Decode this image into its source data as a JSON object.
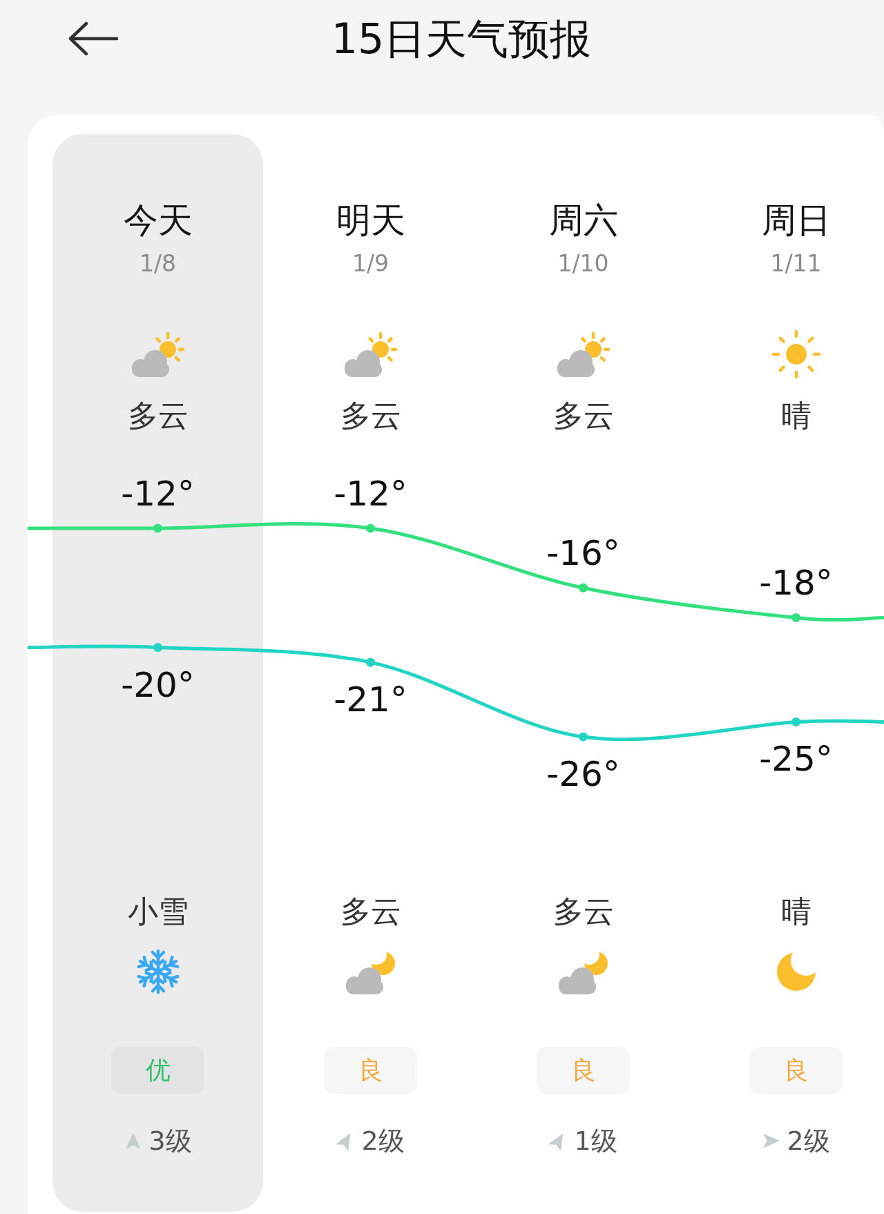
{
  "header": {
    "title": "15日天气预报"
  },
  "forecast": {
    "days": [
      {
        "name": "今天",
        "date": "1/8",
        "selected": true,
        "day_icon": {
          "kind": "partly-cloudy"
        },
        "day_condition": "多云",
        "night_condition": "小雪",
        "night_icon": {
          "kind": "snow"
        },
        "aqi": {
          "label": "优",
          "color": "#2dbf6a"
        },
        "wind_arrow": {
          "kind": "up"
        },
        "wind": "3级"
      },
      {
        "name": "明天",
        "date": "1/9",
        "selected": false,
        "day_icon": {
          "kind": "partly-cloudy"
        },
        "day_condition": "多云",
        "night_condition": "多云",
        "night_icon": {
          "kind": "partly-cloudy-night"
        },
        "aqi": {
          "label": "良",
          "color": "#f5a83a"
        },
        "wind_arrow": {
          "kind": "up-right"
        },
        "wind": "2级"
      },
      {
        "name": "周六",
        "date": "1/10",
        "selected": false,
        "day_icon": {
          "kind": "partly-cloudy"
        },
        "day_condition": "多云",
        "night_condition": "多云",
        "night_icon": {
          "kind": "partly-cloudy-night"
        },
        "aqi": {
          "label": "良",
          "color": "#f5a83a"
        },
        "wind_arrow": {
          "kind": "up-right"
        },
        "wind": "1级"
      },
      {
        "name": "周日",
        "date": "1/11",
        "selected": false,
        "day_icon": {
          "kind": "sunny"
        },
        "day_condition": "晴",
        "night_condition": "晴",
        "night_icon": {
          "kind": "clear-night"
        },
        "aqi": {
          "label": "良",
          "color": "#f5a83a"
        },
        "wind_arrow": {
          "kind": "right"
        },
        "wind": "2级"
      }
    ],
    "chart_data": {
      "type": "line",
      "data_labels": true,
      "series": [
        {
          "color": "#33e07e",
          "marker": "o",
          "values": [
            -12,
            -12,
            -16,
            -18
          ],
          "value_labels": [
            "-12°",
            "-12°",
            "-16°",
            "-18°"
          ]
        },
        {
          "color": "#22d4c4",
          "marker": "o",
          "values": [
            -20,
            -21,
            -26,
            -25
          ],
          "value_labels": [
            "-20°",
            "-21°",
            "-26°",
            "-25°"
          ]
        }
      ]
    }
  }
}
